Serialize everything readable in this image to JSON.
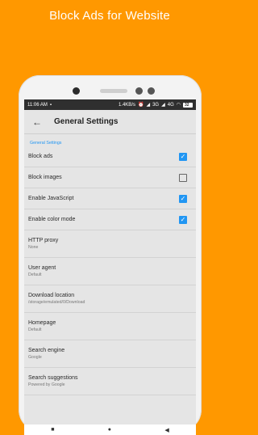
{
  "promo": {
    "title": "Block Ads for Website"
  },
  "status_bar": {
    "time": "11:06 AM",
    "speed": "1.4KB/s",
    "network_3g": "3G",
    "network_4g": "4G",
    "battery": "32"
  },
  "toolbar": {
    "title": "General Settings"
  },
  "settings": {
    "section_header": "General Settings",
    "items": [
      {
        "title": "Block ads",
        "checked": true
      },
      {
        "title": "Block images",
        "checked": false
      },
      {
        "title": "Enable JavaScript",
        "checked": true
      },
      {
        "title": "Enable color mode",
        "checked": true
      },
      {
        "title": "HTTP proxy",
        "subtitle": "None"
      },
      {
        "title": "User agent",
        "subtitle": "Default"
      },
      {
        "title": "Download location",
        "subtitle": "/storage/emulated/0/Download"
      },
      {
        "title": "Homepage",
        "subtitle": "Default"
      },
      {
        "title": "Search engine",
        "subtitle": "Google"
      },
      {
        "title": "Search suggestions",
        "subtitle": "Powered by Google"
      }
    ]
  },
  "colors": {
    "background": "#FF9800",
    "accent": "#2196F3"
  },
  "icons": {
    "check": "✓",
    "back": "←",
    "nav_square": "■",
    "nav_circle": "●",
    "nav_triangle": "◀"
  }
}
